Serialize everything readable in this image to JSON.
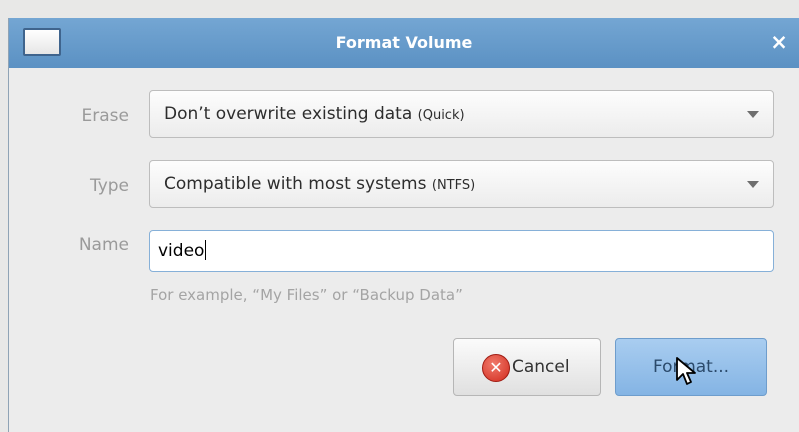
{
  "window": {
    "title": "Format Volume",
    "close_glyph": "×",
    "icon": "window-icon"
  },
  "form": {
    "erase": {
      "label": "Erase",
      "value": "Don’t overwrite existing data",
      "detail": "(Quick)"
    },
    "type": {
      "label": "Type",
      "value": "Compatible with most systems",
      "detail": "(NTFS)"
    },
    "name": {
      "label": "Name",
      "value": "video",
      "hint": "For example, “My Files” or “Backup Data”"
    }
  },
  "buttons": {
    "cancel": {
      "label": "Cancel",
      "icon": "cancel-icon"
    },
    "format": {
      "label": "Format..."
    }
  },
  "colors": {
    "titlebar": "#5b91c3",
    "accent": "#86b0d8",
    "cancel_red": "#d22b1e"
  }
}
